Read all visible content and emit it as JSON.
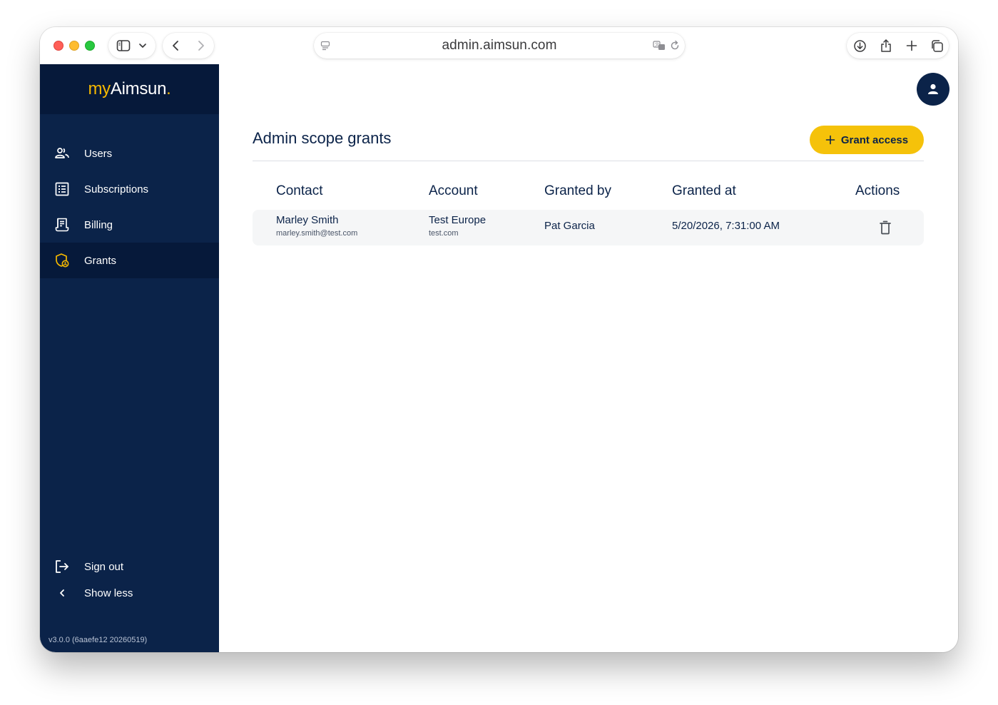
{
  "browser": {
    "url": "admin.aimsun.com"
  },
  "sidebar": {
    "brand": {
      "prefix": "my",
      "name": "Aimsun",
      "suffix": "."
    },
    "items": [
      {
        "label": "Users",
        "icon": "users-icon"
      },
      {
        "label": "Subscriptions",
        "icon": "list-icon"
      },
      {
        "label": "Billing",
        "icon": "receipt-icon"
      },
      {
        "label": "Grants",
        "icon": "shield-grant-icon",
        "active": true
      }
    ],
    "footer_items": [
      {
        "label": "Sign out",
        "icon": "sign-out-icon"
      },
      {
        "label": "Show less",
        "icon": "chevron-left-icon"
      }
    ],
    "version": "v3.0.0 (6aaefe12 20260519)"
  },
  "main": {
    "title": "Admin scope grants",
    "grant_button": "Grant access",
    "table": {
      "headers": [
        "Contact",
        "Account",
        "Granted by",
        "Granted at",
        "Actions"
      ],
      "rows": [
        {
          "contact_name": "Marley Smith",
          "contact_email": "marley.smith@test.com",
          "account_name": "Test Europe",
          "account_domain": "test.com",
          "granted_by": "Pat Garcia",
          "granted_at": "5/20/2026, 7:31:00 AM"
        }
      ]
    }
  },
  "colors": {
    "sidebar_bg": "#0b2349",
    "sidebar_active": "#06193a",
    "accent": "#f5c20a",
    "text_primary": "#0b2349"
  }
}
